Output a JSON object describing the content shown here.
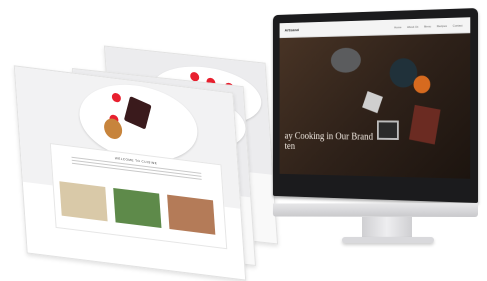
{
  "screen": {
    "logo": "Artisanal",
    "nav": [
      "Home",
      "About Us",
      "Menu",
      "Recipes",
      "Contact"
    ],
    "hero_title": "ay Cooking in Our Brand\nten"
  },
  "card": {
    "title": "WELCOME TO CUISINE"
  },
  "colors": {
    "accent": "#e8202f",
    "screen_bg": "#2e2119",
    "bezel": "#1b1b1d"
  }
}
